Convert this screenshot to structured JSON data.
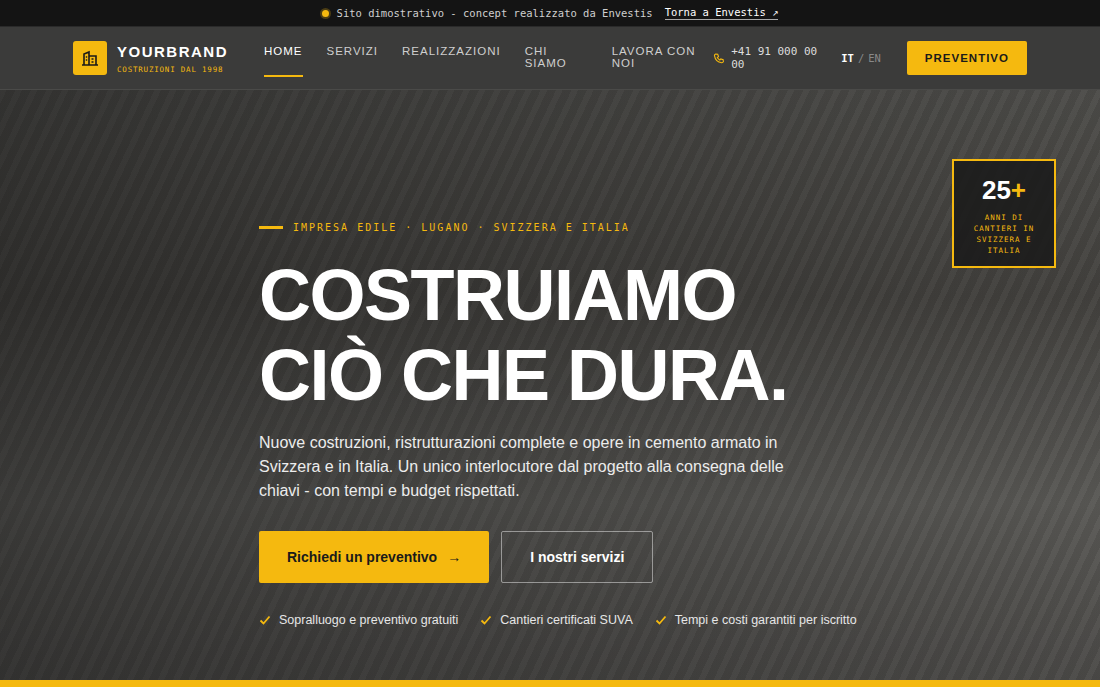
{
  "banner": {
    "text": "Sito dimostrativo - concept realizzato da Envestis",
    "link": "Torna a Envestis ↗"
  },
  "brand": {
    "name": "YOURBRAND",
    "tagline": "COSTRUZIONI DAL 1998"
  },
  "nav": [
    {
      "label": "HOME",
      "selected": true
    },
    {
      "label": "SERVIZI",
      "selected": false
    },
    {
      "label": "REALIZZAZIONI",
      "selected": false
    },
    {
      "label": "CHI SIAMO",
      "selected": false
    },
    {
      "label": "LAVORA CON NOI",
      "selected": false
    }
  ],
  "phone": "+41 91 000 00 00",
  "languages": [
    {
      "label": "IT",
      "selected": true
    },
    {
      "label": "EN",
      "selected": false
    }
  ],
  "language_separator": "/",
  "cta": "PREVENTIVO",
  "hero": {
    "eyebrow": "IMPRESA EDILE · LUGANO · SVIZZERA E ITALIA",
    "title_lines": [
      "COSTRUIAMO",
      "CIÒ CHE DURA."
    ],
    "text": "Nuove costruzioni, ristrutturazioni complete e opere in cemento armato in Svizzera e in Italia. Un unico interlocutore dal progetto alla consegna delle chiavi - con tempi e budget rispettati.",
    "buttons": [
      {
        "label": "Richiedi un preventivo",
        "icon": "→",
        "kind": "primary"
      },
      {
        "label": "I nostri servizi",
        "kind": "secondary"
      }
    ],
    "features": [
      "Sopralluogo e preventivo gratuiti",
      "Cantieri certificati SUVA",
      "Tempi e costi garantiti per iscritto"
    ]
  },
  "badge": {
    "value": "25",
    "suffix": "+",
    "text": "ANNI DI CANTIERI IN SVIZZERA E ITALIA"
  }
}
